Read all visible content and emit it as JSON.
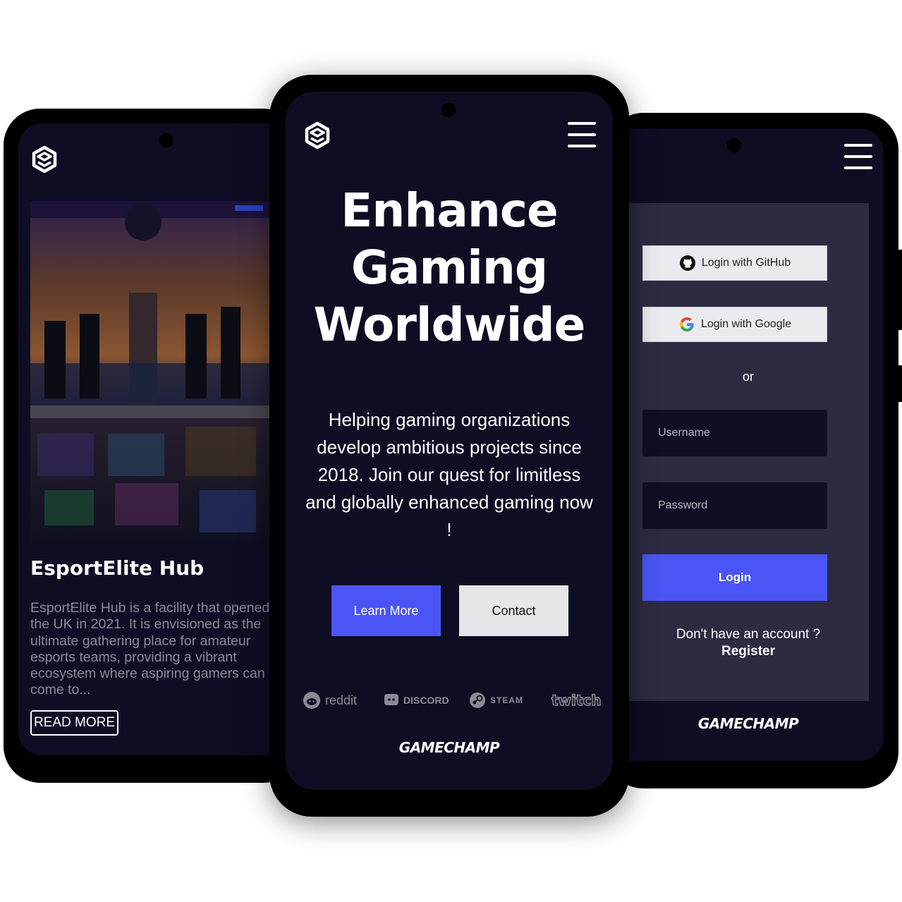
{
  "left_screen": {
    "card": {
      "title": "EsportElite Hub",
      "description": "EsportElite Hub is a facility that opened in the UK in 2021. It is envisioned as the ultimate gathering place for amateur esports teams, providing a vibrant ecosystem where aspiring gamers can come to...",
      "button_label": "READ MORE"
    }
  },
  "center_screen": {
    "headline_lines": [
      "Enhance",
      "Gaming",
      "Worldwide"
    ],
    "subtext": "Helping gaming organizations develop ambitious projects since 2018. Join our quest for limitless and globally enhanced gaming now !",
    "buttons": {
      "learn_more": "Learn More",
      "contact": "Contact"
    },
    "partners": [
      "reddit",
      "DISCORD",
      "STEAM",
      "twitch"
    ],
    "brand": "GAMECHAMP"
  },
  "right_screen": {
    "oauth": {
      "github": "Login with GitHub",
      "google": "Login with Google"
    },
    "or_label": "or",
    "username_placeholder": "Username",
    "password_placeholder": "Password",
    "login_label": "Login",
    "no_account_text": "Don't have an account ?",
    "register_label": "Register",
    "brand": "GAMECHAMP"
  },
  "colors": {
    "screen_bg": "#0e0d23",
    "panel_bg": "#2c2b42",
    "accent": "#4b55f6",
    "light_button": "#e6e6ea"
  },
  "icons": [
    "logo-icon",
    "hamburger-menu-icon",
    "github-icon",
    "google-icon",
    "reddit-icon",
    "discord-icon",
    "steam-icon",
    "twitch-icon"
  ]
}
